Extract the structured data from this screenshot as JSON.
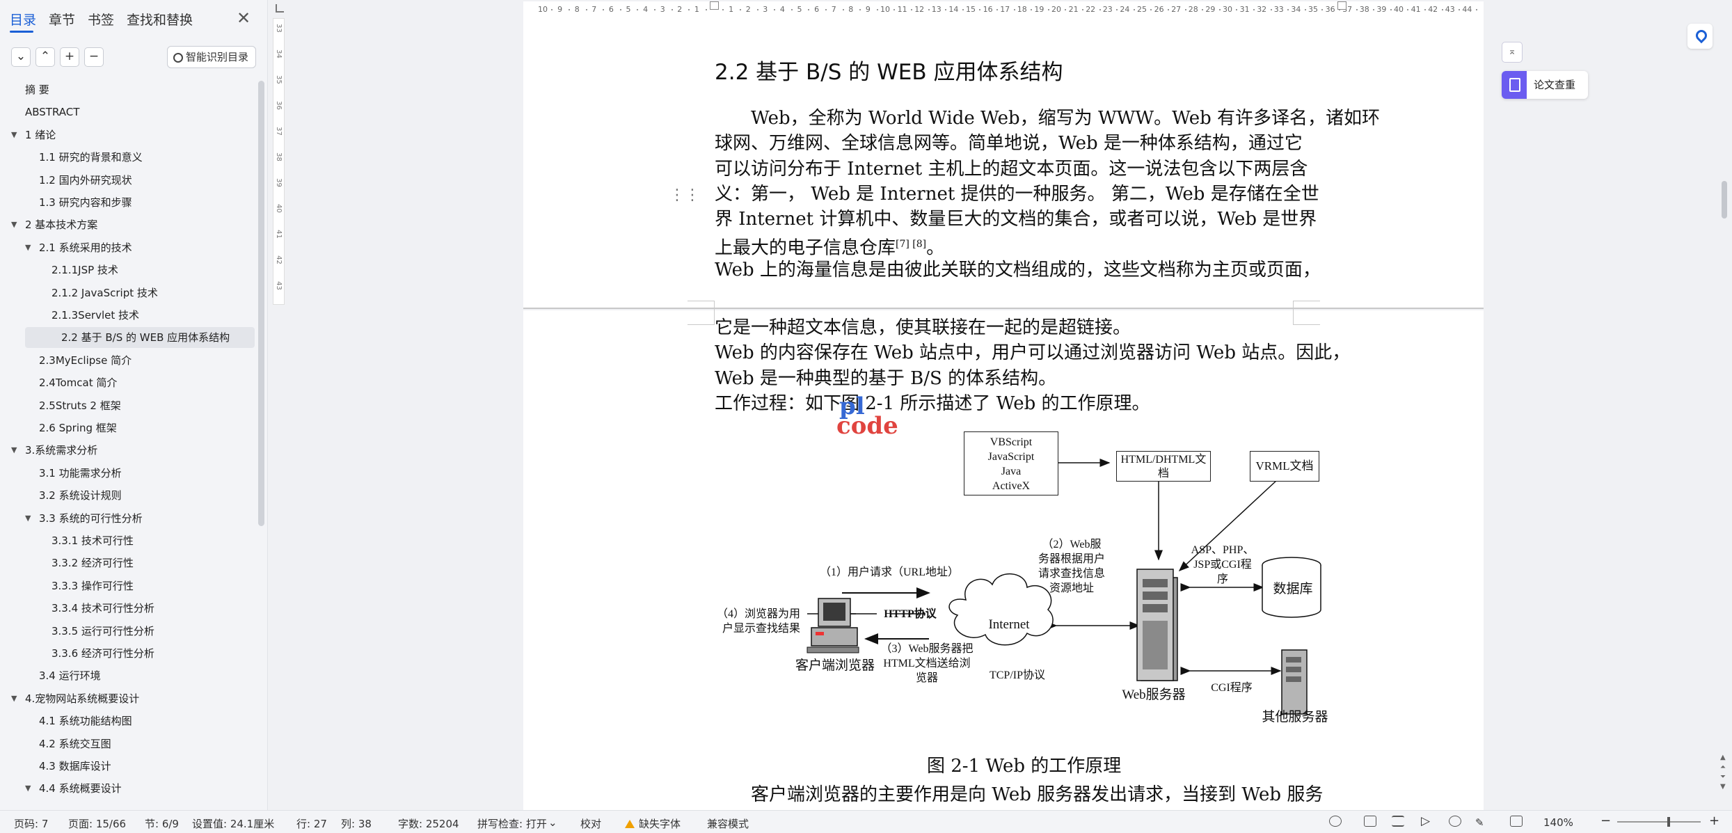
{
  "nav": {
    "tabs": [
      "目录",
      "章节",
      "书签",
      "查找和替换"
    ],
    "close": "✕",
    "tools": [
      "⌄",
      "⌃",
      "+",
      "−"
    ],
    "smart_toc_label": "智能识别目录",
    "toc": [
      {
        "label": "摘 要",
        "level": 1,
        "arrow": false
      },
      {
        "label": "ABSTRACT",
        "level": 1,
        "arrow": false
      },
      {
        "label": "1 绪论",
        "level": 1,
        "arrow": true
      },
      {
        "label": "1.1 研究的背景和意义",
        "level": 2,
        "arrow": false
      },
      {
        "label": "1.2 国内外研究现状",
        "level": 2,
        "arrow": false
      },
      {
        "label": "1.3 研究内容和步骤",
        "level": 2,
        "arrow": false
      },
      {
        "label": "2 基本技术方案",
        "level": 1,
        "arrow": true
      },
      {
        "label": "2.1 系统采用的技术",
        "level": 2,
        "arrow": true
      },
      {
        "label": "2.1.1JSP 技术",
        "level": 3,
        "arrow": false
      },
      {
        "label": "2.1.2 JavaScript 技术",
        "level": 3,
        "arrow": false
      },
      {
        "label": "2.1.3Servlet 技术",
        "level": 3,
        "arrow": false
      },
      {
        "label": "2.2 基于 B/S 的 WEB 应用体系结构",
        "level": 2,
        "arrow": false,
        "selected": true
      },
      {
        "label": "2.3MyEclipse 简介",
        "level": 2,
        "arrow": false
      },
      {
        "label": "2.4Tomcat 简介",
        "level": 2,
        "arrow": false
      },
      {
        "label": "2.5Struts 2 框架",
        "level": 2,
        "arrow": false
      },
      {
        "label": "2.6 Spring 框架",
        "level": 2,
        "arrow": false
      },
      {
        "label": "3.系统需求分析",
        "level": 1,
        "arrow": true
      },
      {
        "label": "3.1 功能需求分析",
        "level": 2,
        "arrow": false
      },
      {
        "label": "3.2 系统设计规则",
        "level": 2,
        "arrow": false
      },
      {
        "label": "3.3 系统的可行性分析",
        "level": 2,
        "arrow": true
      },
      {
        "label": "3.3.1 技术可行性",
        "level": 3,
        "arrow": false
      },
      {
        "label": "3.3.2 经济可行性",
        "level": 3,
        "arrow": false
      },
      {
        "label": "3.3.3 操作可行性",
        "level": 3,
        "arrow": false
      },
      {
        "label": "3.3.4  技术可行性分析",
        "level": 3,
        "arrow": false
      },
      {
        "label": "3.3.5  运行可行性分析",
        "level": 3,
        "arrow": false
      },
      {
        "label": "3.3.6  经济可行性分析",
        "level": 3,
        "arrow": false
      },
      {
        "label": "3.4 运行环境",
        "level": 2,
        "arrow": false
      },
      {
        "label": "4.宠物网站系统概要设计",
        "level": 1,
        "arrow": true
      },
      {
        "label": "4.1 系统功能结构图",
        "level": 2,
        "arrow": false
      },
      {
        "label": "4.2 系统交互图",
        "level": 2,
        "arrow": false
      },
      {
        "label": "4.3 数据库设计",
        "level": 2,
        "arrow": false
      },
      {
        "label": "4.4 系统概要设计",
        "level": 2,
        "arrow": true
      }
    ]
  },
  "ruler": {
    "h_left": [
      "10",
      "9",
      "8",
      "7",
      "6",
      "5",
      "4",
      "3",
      "2",
      "1"
    ],
    "h_right": [
      "1",
      "2",
      "3",
      "4",
      "5",
      "6",
      "7",
      "8",
      "9",
      "10",
      "11",
      "12",
      "13",
      "14",
      "15",
      "16",
      "17",
      "18",
      "19",
      "20",
      "21",
      "22",
      "23",
      "24",
      "25",
      "26",
      "27",
      "28",
      "29",
      "30",
      "31",
      "32",
      "33",
      "34",
      "35",
      "36",
      "37",
      "38",
      "39",
      "40",
      "41",
      "42",
      "43",
      "44"
    ],
    "v": [
      "33",
      "34",
      "35",
      "36",
      "37",
      "38",
      "39",
      "40",
      "41",
      "42",
      "43"
    ]
  },
  "doc": {
    "heading": "2.2 基于 B/S 的 WEB 应用体系结构",
    "p1_lines": [
      "Web，全称为 World Wide Web，缩写为 WWW。Web 有许多译名，诸如环",
      "球网、万维网、全球信息网等。简单地说，Web 是一种体系结构，通过它",
      "可以访问分布于 Internet 主机上的超文本页面。这一说法包含以下两层含",
      "义：第一， Web 是 Internet 提供的一种服务。 第二，Web 是存储在全世",
      "界 Internet 计算机中、数量巨大的文档的集合，或者可以说，Web 是世界"
    ],
    "p1_last": "上最大的电子信息仓库",
    "p1_ref": "[7] [8]",
    "p1_end": "。",
    "p2_line": "Web 上的海量信息是由彼此关联的文档组成的，这些文档称为主页或页面，",
    "p3_line": "它是一种超文本信息，使其联接在一起的是超链接。",
    "p4_lines": [
      "Web 的内容保存在 Web 站点中，用户可以通过浏览器访问 Web 站点。因此，",
      "Web 是一种典型的基于 B/S 的体系结构。"
    ],
    "p5_line": "工作过程：如下图 2-1 所示描述了 Web 的工作原理。",
    "watermark_top": "pl",
    "watermark_bottom": "code",
    "caption": "图 2-1  Web 的工作原理",
    "p6_line": "客户端浏览器的主要作用是向 Web 服务器发出请求，当接到 Web 服务"
  },
  "diagram": {
    "script_box": [
      "VBScript",
      "JavaScript",
      "Java",
      "ActiveX"
    ],
    "html_box": "HTML/DHTML文档",
    "vrml_box": "VRML文档",
    "step1": "（1）用户请求（URL地址）",
    "step2": "（2）Web服务器根据用户请求查找信息资源地址",
    "step3": "（3）Web服务器把HTML文档送给浏览器",
    "step4": "（4）浏览器为用户显示查找结果",
    "http": "HTTP协议",
    "tcpip": "TCP/IP协议",
    "internet": "Internet",
    "client": "客户端浏览器",
    "webserver": "Web服务器",
    "asp": "ASP、PHP、JSP或CGI程序",
    "database": "数据库",
    "cgi": "CGI程序",
    "other": "其他服务器"
  },
  "right": {
    "check_label": "论文查重",
    "collapse": "⌅"
  },
  "status": {
    "page_code": "页码: 7",
    "page": "页面: 15/66",
    "section": "节: 6/9",
    "setting": "设置值: 24.1厘米",
    "row": "行: 27",
    "col": "列: 38",
    "words": "字数: 25204",
    "spell": "拼写检查: 打开",
    "proof": "校对",
    "missing_font": "缺失字体",
    "compat": "兼容模式",
    "zoom": "140%"
  },
  "colors": {
    "accent": "#1a5fd6",
    "selected_bg": "#e3e5ea",
    "check_icon": "#6b5cf0",
    "watermark_top": "#3568d4",
    "watermark_bottom": "#e0443f"
  }
}
